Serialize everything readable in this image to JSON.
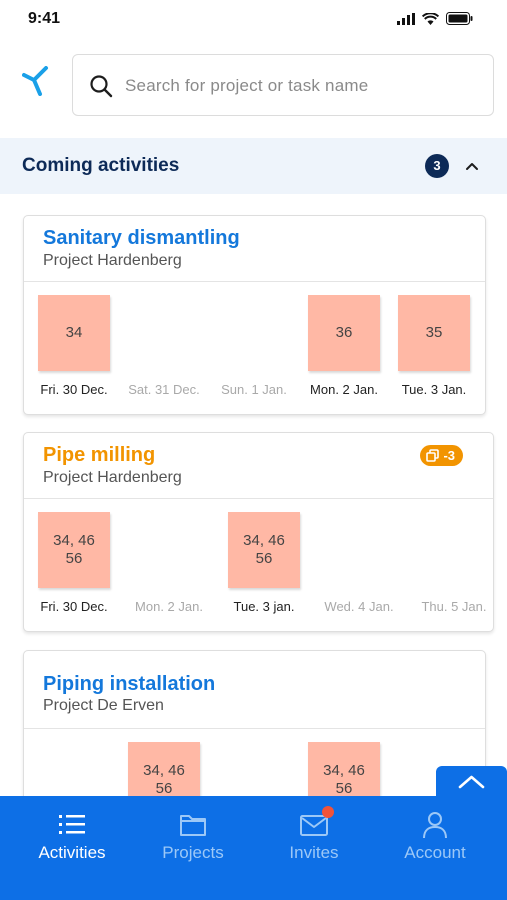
{
  "status": {
    "time": "9:41"
  },
  "search": {
    "placeholder": "Search for project or task name"
  },
  "section": {
    "title": "Coming activities",
    "count": "3"
  },
  "cards": [
    {
      "title": "Sanitary dismantling",
      "project": "Project Hardenberg",
      "days": [
        {
          "label": "Fri. 30 Dec.",
          "note": "34",
          "muted": false
        },
        {
          "label": "Sat. 31 Dec.",
          "note": "",
          "muted": true
        },
        {
          "label": "Sun. 1 Jan.",
          "note": "",
          "muted": true
        },
        {
          "label": "Mon. 2 Jan.",
          "note": "36",
          "muted": false
        },
        {
          "label": "Tue. 3 Jan.",
          "note": "35",
          "muted": false
        }
      ]
    },
    {
      "title": "Pipe milling",
      "project": "Project Hardenberg",
      "badge": "-3",
      "days": [
        {
          "label": "Fri. 30 Dec.",
          "note": "34, 46\n56",
          "muted": false
        },
        {
          "label": "Mon. 2 Jan.",
          "note": "",
          "muted": true
        },
        {
          "label": "Tue. 3 jan.",
          "note": "34, 46\n56",
          "muted": false
        },
        {
          "label": "Wed. 4 Jan.",
          "note": "",
          "muted": true
        },
        {
          "label": "Thu. 5 Jan.",
          "note": "",
          "muted": true
        }
      ]
    },
    {
      "title": "Piping installation",
      "project": "Project De Erven",
      "days": [
        {
          "note": ""
        },
        {
          "note": "34, 46\n56"
        },
        {
          "note": ""
        },
        {
          "note": "34, 46\n56"
        },
        {
          "note": ""
        }
      ]
    }
  ],
  "tabs": [
    {
      "label": "Activities",
      "icon": "list-icon",
      "active": true
    },
    {
      "label": "Projects",
      "icon": "folder-icon",
      "active": false
    },
    {
      "label": "Invites",
      "icon": "mail-icon",
      "active": false
    },
    {
      "label": "Account",
      "icon": "user-icon",
      "active": false
    }
  ],
  "colors": {
    "primary": "#0d6fe6",
    "navy": "#0d2a57",
    "link_blue": "#1478db",
    "orange": "#f29400",
    "sticky_note": "#ffb8a5",
    "notification": "#f0533a"
  }
}
